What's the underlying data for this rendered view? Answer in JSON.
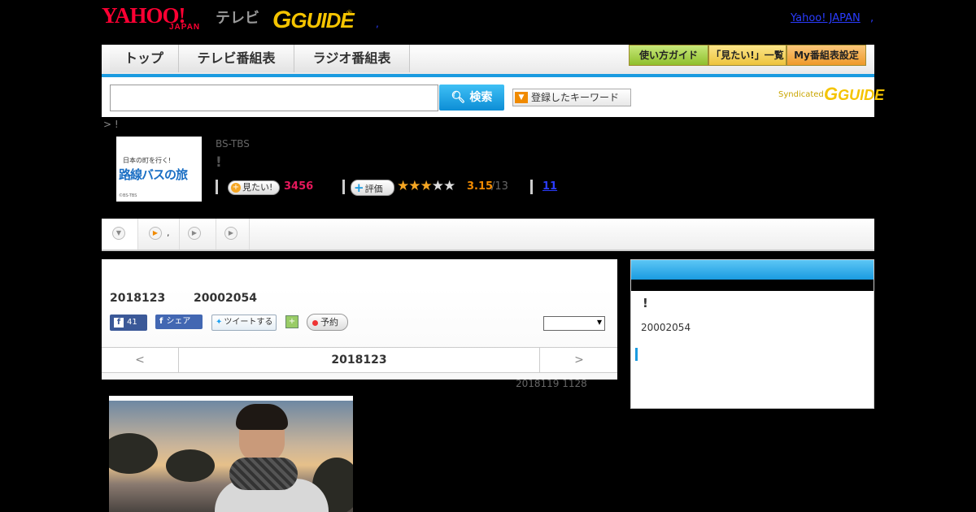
{
  "header": {
    "yahoo_logo": "YAHOO!",
    "yahoo_sub": "JAPAN",
    "tv_label": "テレビ",
    "gguide_logo": "GUIDE",
    "reg_mark": "®",
    "yahoo_japan_link": "Yahoo! JAPAN",
    "link_sep": ",",
    "header_comma": ","
  },
  "nav": {
    "tabs": [
      "トップ",
      "テレビ番組表",
      "ラジオ番組表"
    ],
    "buttons": [
      "使い方ガイド",
      "「見たい!」一覧",
      "My番組表設定"
    ],
    "button_colors": [
      "#9ccc3c",
      "#f3d25a",
      "#f4a53a"
    ]
  },
  "search": {
    "input_value": "",
    "select_value": "",
    "search_button": "検索",
    "keyword_button": "登録したキーワード",
    "syndicated_label": "Syndicated",
    "syndicated_logo": "GUIDE"
  },
  "breadcrumb": " > !",
  "program": {
    "thumbnail_top_text": "日本の町を行く!",
    "thumbnail_title": "路線バスの旅",
    "thumbnail_credit": "©BS-TBS",
    "channel": "BS-TBS",
    "title": "!",
    "mitai_label": "見たい!",
    "mitai_count": "3456",
    "rating_label": "評価",
    "stars_filled": 3,
    "stars_total": 5,
    "rating_value": "3.15",
    "rating_count": "/13",
    "comment_count": "11"
  },
  "tabs_row": {
    "second_tab_text": ","
  },
  "broadcast": {
    "date": "2018123",
    "time": "20002054",
    "fb_like_count": "41",
    "fb_share_label": "シェア",
    "tweet_label": "ツイートする",
    "reserve_label": "予約",
    "select_value": "",
    "nav_prev": "<",
    "nav_date": "2018123",
    "nav_next": ">",
    "updated": "2018119  1128"
  },
  "side_panel": {
    "title": "!",
    "time": "20002054"
  },
  "colors": {
    "accent_blue": "#1a9be0",
    "pink_count": "#e6185c",
    "orange_rating": "#f08a00",
    "link_blue": "#2a3cff",
    "yahoo_red": "#ff0033",
    "gguide_yellow": "#f5c400"
  }
}
